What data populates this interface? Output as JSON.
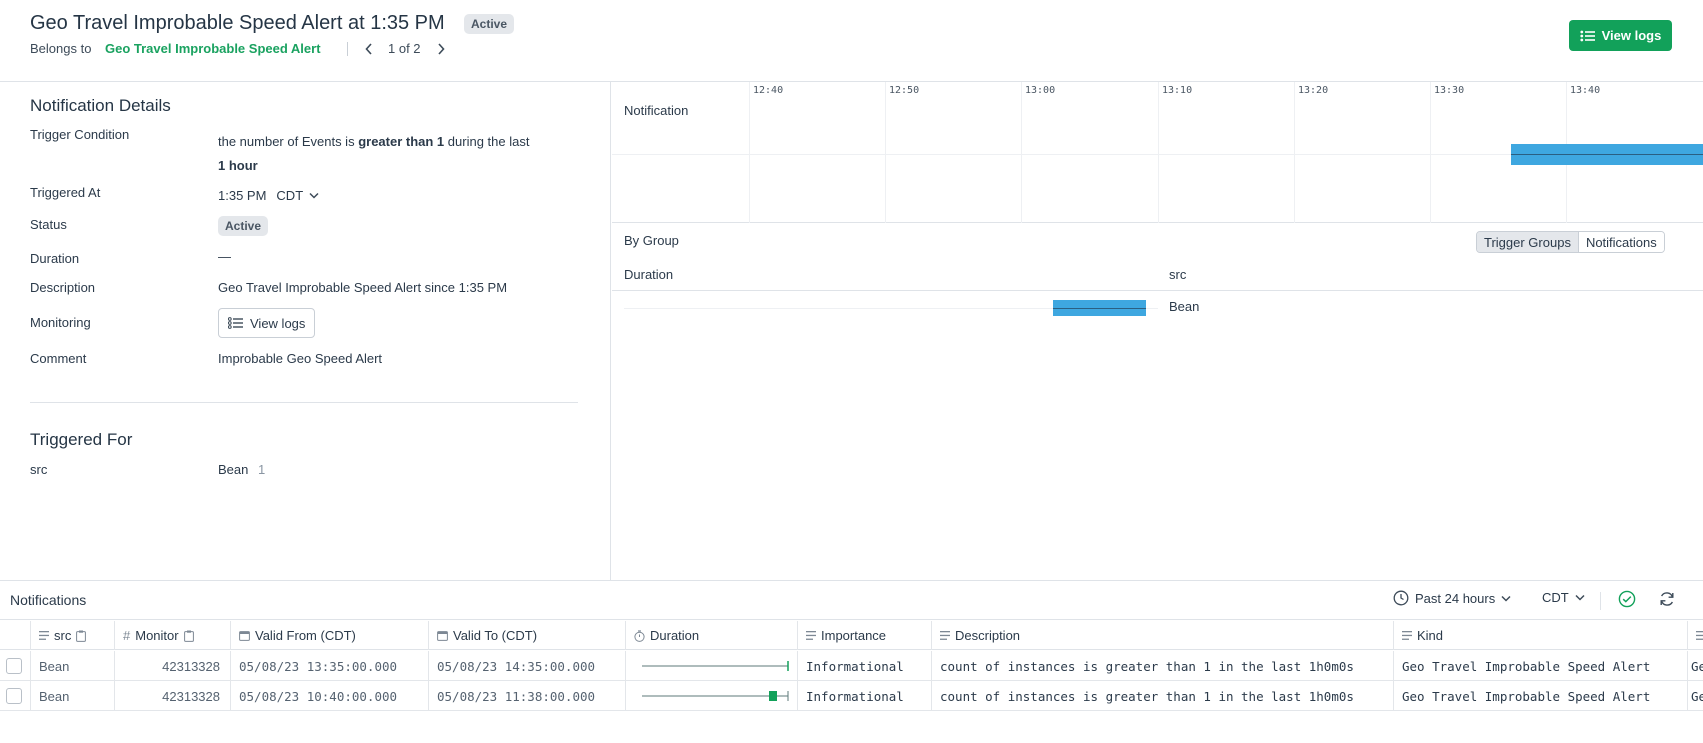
{
  "header": {
    "title": "Geo Travel Improbable Speed Alert at 1:35 PM",
    "status_badge": "Active",
    "belongs_to_label": "Belongs to",
    "belongs_to_link": "Geo Travel Improbable Speed Alert",
    "pager": "1 of 2",
    "view_logs_label": "View logs"
  },
  "details": {
    "section_title": "Notification Details",
    "trigger_condition_label": "Trigger Condition",
    "trigger_condition_prefix": "the number of Events is ",
    "trigger_condition_operator": "greater than  1",
    "trigger_condition_suffix": "  during the last",
    "trigger_condition_window": "1  hour",
    "triggered_at_label": "Triggered At",
    "triggered_at_time": "1:35 PM",
    "triggered_at_tz": "CDT",
    "status_label": "Status",
    "status_value": "Active",
    "duration_label": "Duration",
    "duration_value": "—",
    "description_label": "Description",
    "description_value": "Geo Travel Improbable Speed Alert since 1:35 PM",
    "monitoring_label": "Monitoring",
    "monitoring_button": "View logs",
    "comment_label": "Comment",
    "comment_value": "Improbable Geo Speed Alert"
  },
  "triggered_for": {
    "section_title": "Triggered For",
    "key": "src",
    "value": "Bean",
    "count": "1"
  },
  "timeline": {
    "row_label": "Notification",
    "ticks": [
      "12:40",
      "12:50",
      "13:00",
      "13:10",
      "13:20",
      "13:30",
      "13:40"
    ]
  },
  "by_group": {
    "title": "By Group",
    "tabs": [
      "Trigger Groups",
      "Notifications"
    ],
    "active_tab": "Trigger Groups",
    "col_duration": "Duration",
    "col_src": "src",
    "row_src": "Bean"
  },
  "notifications": {
    "title": "Notifications",
    "time_range": "Past 24 hours",
    "timezone": "CDT",
    "columns": [
      "src",
      "Monitor",
      "Valid From (CDT)",
      "Valid To (CDT)",
      "Duration",
      "Importance",
      "Description",
      "Kind"
    ],
    "rows": [
      {
        "src": "Bean",
        "monitor": "42313328",
        "valid_from": "05/08/23 13:35:00.000",
        "valid_to": "05/08/23 14:35:00.000",
        "importance": "Informational",
        "description": "count of instances is greater than 1 in the last 1h0m0s",
        "kind": "Geo Travel Improbable Speed Alert",
        "overflow": "Ge"
      },
      {
        "src": "Bean",
        "monitor": "42313328",
        "valid_from": "05/08/23 10:40:00.000",
        "valid_to": "05/08/23 11:38:00.000",
        "importance": "Informational",
        "description": "count of instances is greater than 1 in the last 1h0m0s",
        "kind": "Geo Travel Improbable Speed Alert",
        "overflow": "Ge"
      }
    ]
  },
  "colors": {
    "accent_green": "#12a15a",
    "bar_blue": "#3ea7e0",
    "text": "#2b3a4a"
  }
}
